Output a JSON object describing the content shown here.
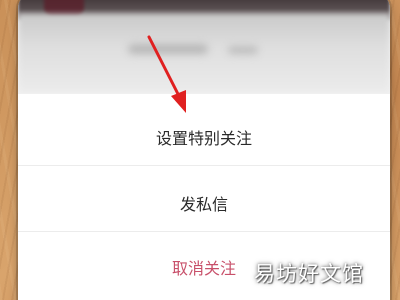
{
  "menu": {
    "items": [
      {
        "label": "设置特别关注"
      },
      {
        "label": "发私信"
      },
      {
        "label": "取消关注"
      }
    ]
  },
  "watermark": {
    "text": "易坊好文馆"
  },
  "colors": {
    "destructive_text": "#c8506a",
    "arrow": "#e02020",
    "background_wood": "#d0985e"
  }
}
